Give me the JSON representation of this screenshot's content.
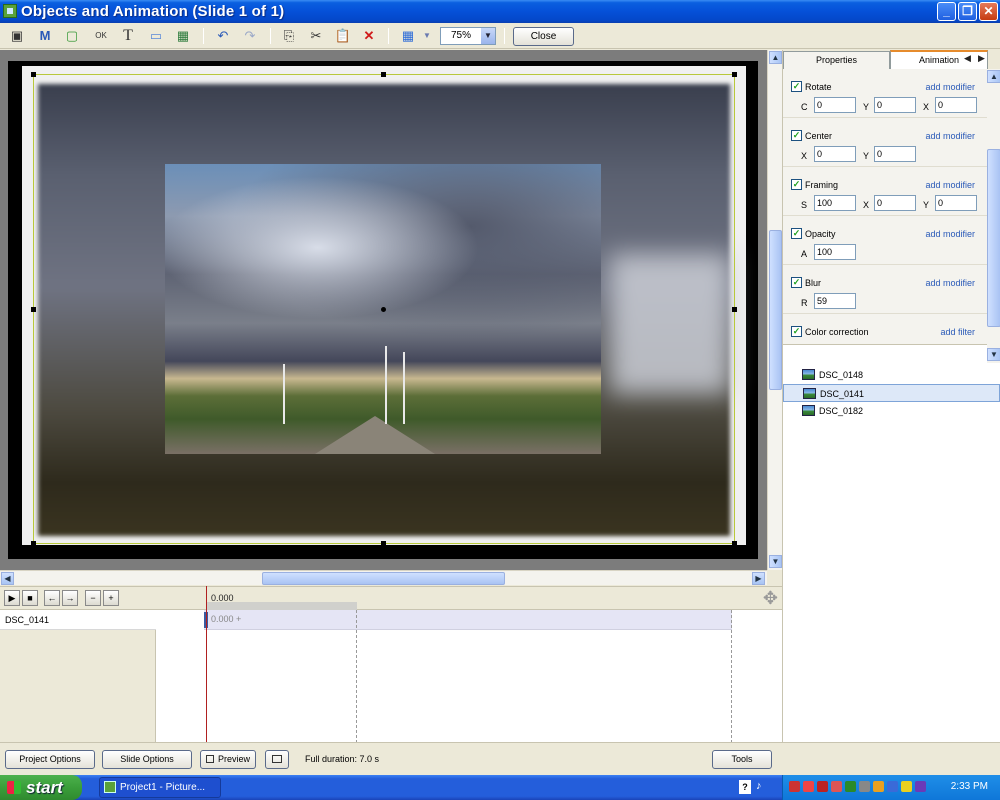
{
  "window": {
    "title": "Objects and Animation (Slide 1 of 1)"
  },
  "toolbar": {
    "zoom_value": "75%",
    "close_label": "Close"
  },
  "panel": {
    "tabs": [
      {
        "label": "Properties"
      },
      {
        "label": "Animation"
      }
    ],
    "modifiers": [
      {
        "label": "Rotate",
        "link": "add modifier",
        "fields": [
          {
            "label": "C",
            "value": "0"
          },
          {
            "label": "Y",
            "value": "0"
          },
          {
            "label": "X",
            "value": "0"
          }
        ]
      },
      {
        "label": "Center",
        "link": "add modifier",
        "fields": [
          {
            "label": "X",
            "value": "0"
          },
          {
            "label": "Y",
            "value": "0"
          }
        ]
      },
      {
        "label": "Framing",
        "link": "add modifier",
        "fields": [
          {
            "label": "S",
            "value": "100"
          },
          {
            "label": "X",
            "value": "0"
          },
          {
            "label": "Y",
            "value": "0"
          }
        ]
      },
      {
        "label": "Opacity",
        "link": "add modifier",
        "fields": [
          {
            "label": "A",
            "value": "100"
          }
        ]
      },
      {
        "label": "Blur",
        "link": "add modifier",
        "fields": [
          {
            "label": "R",
            "value": "59"
          }
        ]
      },
      {
        "label": "Color correction",
        "link": "add filter",
        "fields": []
      }
    ],
    "objects": [
      {
        "name": "DSC_0148"
      },
      {
        "name": "DSC_0141"
      },
      {
        "name": "DSC_0182"
      }
    ]
  },
  "timeline": {
    "time_display": "0.000",
    "track_name": "DSC_0141",
    "key_label": "0.000 +"
  },
  "bottom": {
    "project_options": "Project Options",
    "slide_options": "Slide Options",
    "preview": "Preview",
    "full_duration": "Full duration: 7.0 s",
    "tools": "Tools"
  },
  "taskbar": {
    "start_label": "start",
    "task_item": "Project1 - Picture...",
    "clock": "2:33 PM",
    "lang": "?"
  },
  "colors": {
    "titlebar": "#0550d8",
    "selection_border": "#b8c83a",
    "tab_accent": "#e68b2c",
    "link": "#2a5ab8"
  }
}
